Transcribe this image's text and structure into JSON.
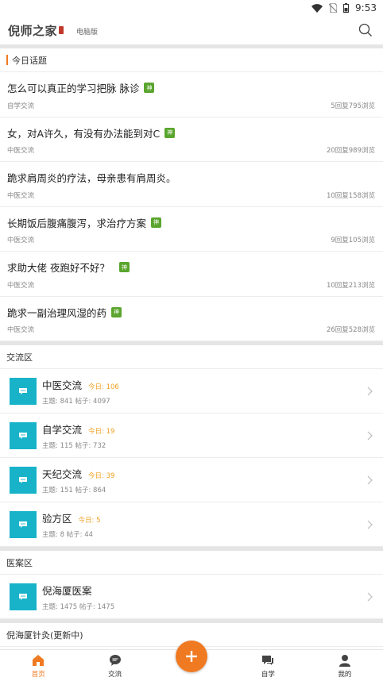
{
  "status_bar": {
    "time": "9:53"
  },
  "header": {
    "logo": "倪师之家",
    "pc_version": "电脑版"
  },
  "today_topics": {
    "title": "今日话题",
    "items": [
      {
        "title": "怎么可以真正的学习把脉 脉诊",
        "badge": "神",
        "category": "自学交流",
        "stats": "5回复795浏览"
      },
      {
        "title": "女，对A许久，有没有办法能到对C",
        "badge": "神",
        "category": "中医交流",
        "stats": "20回复989浏览"
      },
      {
        "title": "跪求肩周炎的疗法，母亲患有肩周炎。",
        "badge": "",
        "category": "中医交流",
        "stats": "10回复158浏览"
      },
      {
        "title": "长期饭后腹痛腹泻，求治疗方案",
        "badge": "神",
        "category": "中医交流",
        "stats": "9回复105浏览"
      },
      {
        "title": "求助大佬 夜跑好不好？",
        "badge": "神",
        "category": "中医交流",
        "stats": "10回复213浏览"
      },
      {
        "title": "跪求一副治理风湿的药",
        "badge": "神",
        "category": "中医交流",
        "stats": "26回复528浏览"
      }
    ]
  },
  "exchange_zone": {
    "title": "交流区",
    "forums": [
      {
        "name": "中医交流",
        "today": "今日: 106",
        "stats": "主题: 841  帖子: 4097"
      },
      {
        "name": "自学交流",
        "today": "今日: 19",
        "stats": "主题: 115  帖子: 732"
      },
      {
        "name": "天纪交流",
        "today": "今日: 39",
        "stats": "主题: 151  帖子: 864"
      },
      {
        "name": "验方区",
        "today": "今日: 5",
        "stats": "主题: 8  帖子: 44"
      }
    ]
  },
  "case_zone": {
    "title": "医案区",
    "forums": [
      {
        "name": "倪海厦医案",
        "today": "",
        "stats": "主题: 1475  帖子: 1475"
      }
    ]
  },
  "acupuncture_zone": {
    "title": "倪海厦针灸(更新中)"
  },
  "bottom_nav": {
    "home": "首页",
    "exchange": "交流",
    "study": "自学",
    "mine": "我的"
  },
  "colors": {
    "accent": "#f07a22",
    "forum_icon": "#18b3c9",
    "badge": "#5aa52e",
    "today": "#f0a020"
  }
}
